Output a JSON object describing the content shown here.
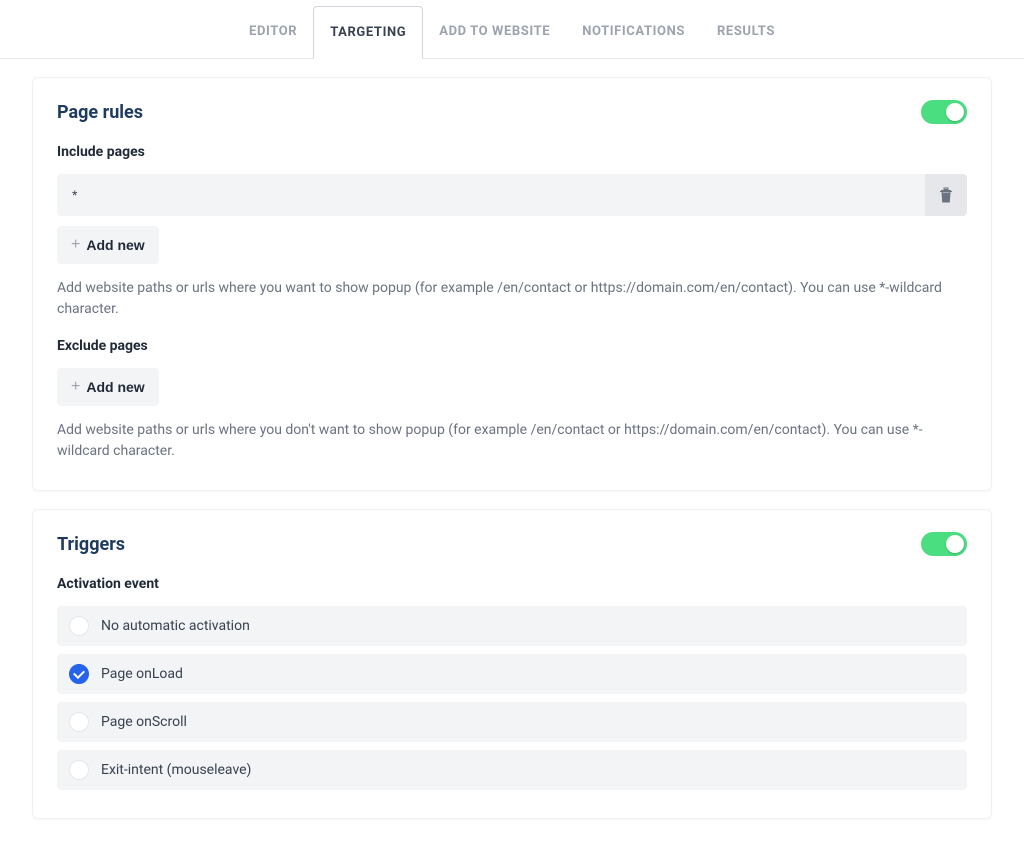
{
  "tabs": [
    {
      "label": "EDITOR",
      "active": false
    },
    {
      "label": "TARGETING",
      "active": true
    },
    {
      "label": "ADD TO WEBSITE",
      "active": false
    },
    {
      "label": "NOTIFICATIONS",
      "active": false
    },
    {
      "label": "RESULTS",
      "active": false
    }
  ],
  "pageRules": {
    "title": "Page rules",
    "enabled": true,
    "include": {
      "label": "Include pages",
      "items": [
        "*"
      ],
      "addButton": "Add new",
      "helpText": "Add website paths or urls where you want to show popup (for example /en/contact or https://domain.com/en/contact). You can use *-wildcard character."
    },
    "exclude": {
      "label": "Exclude pages",
      "addButton": "Add new",
      "helpText": "Add website paths or urls where you don't want to show popup (for example /en/contact or https://domain.com/en/contact). You can use *-wildcard character."
    }
  },
  "triggers": {
    "title": "Triggers",
    "enabled": true,
    "activationLabel": "Activation event",
    "options": [
      {
        "label": "No automatic activation",
        "checked": false
      },
      {
        "label": "Page onLoad",
        "checked": true
      },
      {
        "label": "Page onScroll",
        "checked": false
      },
      {
        "label": "Exit-intent (mouseleave)",
        "checked": false
      }
    ]
  }
}
